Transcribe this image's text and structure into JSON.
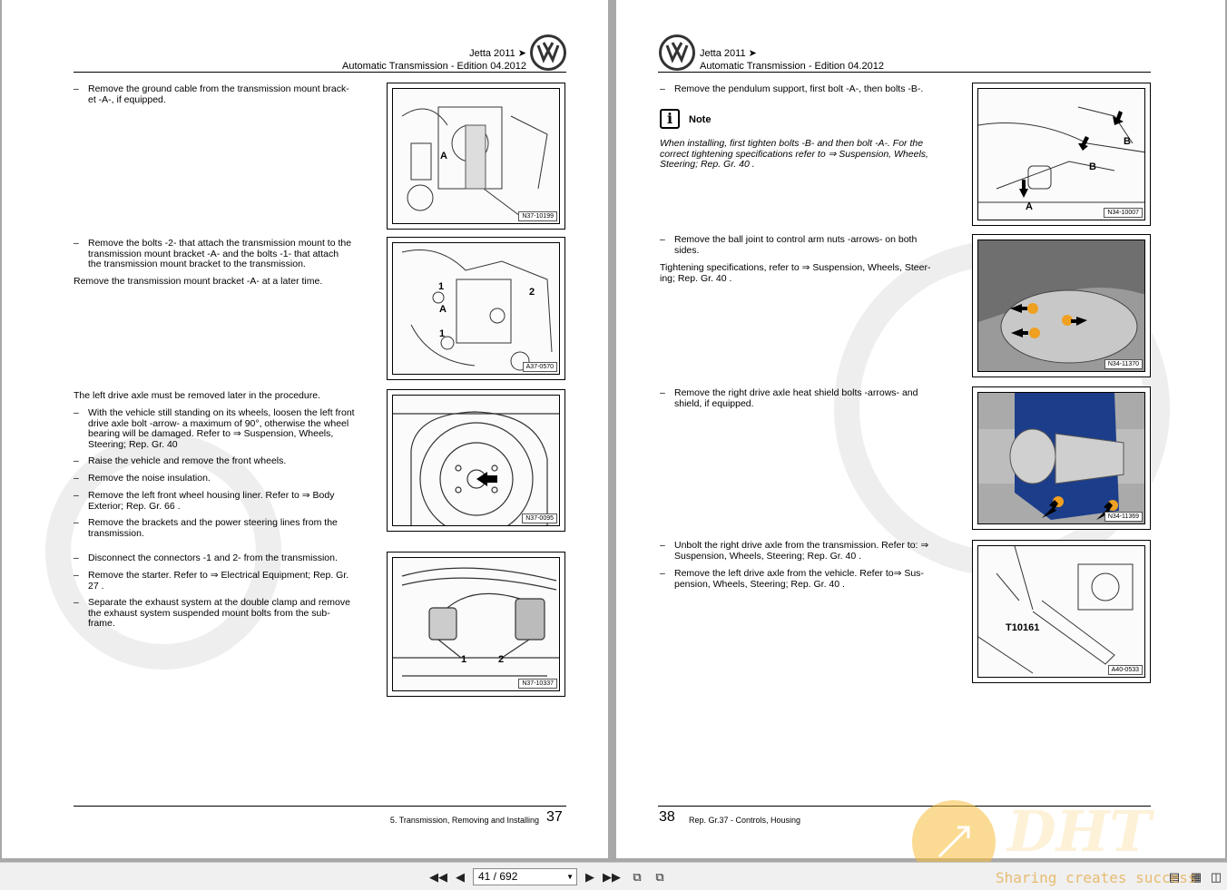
{
  "left_page": {
    "header": {
      "title": "Jetta 2011 ➤",
      "subtitle": "Automatic Transmission - Edition 04.2012"
    },
    "steps": [
      {
        "dash": "–",
        "text": "Remove the ground cable from the transmission mount brack-\net -A-, if equipped."
      },
      {
        "dash": "–",
        "text": "Remove the bolts -2- that attach the transmission mount to the\ntransmission mount bracket -A- and the bolts -1- that attach\nthe transmission mount bracket to the transmission."
      },
      {
        "dash": "–",
        "text": "With the vehicle still standing on its wheels, loosen the left front\ndrive axle bolt -arrow- a maximum of 90°, otherwise the wheel\nbearing will be damaged. Refer to ⇒ Suspension, Wheels,\nSteering; Rep. Gr. 40"
      },
      {
        "dash": "–",
        "text": "Raise the vehicle and remove the front wheels."
      },
      {
        "dash": "–",
        "text": "Remove the noise insulation."
      },
      {
        "dash": "–",
        "text": "Remove the left front wheel housing liner. Refer to ⇒ Body\nExterior; Rep. Gr. 66 ."
      },
      {
        "dash": "–",
        "text": "Remove the brackets and the power steering lines from the\ntransmission."
      },
      {
        "dash": "–",
        "text": "Disconnect the connectors -1 and 2- from the transmission."
      },
      {
        "dash": "–",
        "text": "Remove the starter. Refer to ⇒ Electrical Equipment; Rep. Gr.\n27 ."
      },
      {
        "dash": "–",
        "text": "Separate the exhaust system at the double clamp and remove\nthe exhaust system suspended mount bolts from the sub-\nframe."
      }
    ],
    "plain": [
      "Remove the transmission mount bracket -A- at a later time.",
      "The left drive axle must be removed later in the procedure."
    ],
    "figures": [
      {
        "label": "N37-10199",
        "callouts": [
          "A"
        ]
      },
      {
        "label": "A37-0570",
        "callouts": [
          "1",
          "2",
          "A",
          "1"
        ]
      },
      {
        "label": "N37-0095",
        "callouts": []
      },
      {
        "label": "N37-10337",
        "callouts": [
          "1",
          "2"
        ]
      }
    ],
    "footer": {
      "section": "5. Transmission, Removing and Installing",
      "page": "37"
    }
  },
  "right_page": {
    "header": {
      "title": "Jetta 2011 ➤",
      "subtitle": "Automatic Transmission - Edition 04.2012"
    },
    "steps": [
      {
        "dash": "–",
        "text": "Remove the pendulum support, first bolt -A-, then bolts -B-."
      },
      {
        "dash": "–",
        "text": "Remove the ball joint to control arm nuts -arrows- on both\nsides."
      },
      {
        "dash": "–",
        "text": "Remove the right drive axle heat shield bolts -arrows- and\nshield, if equipped."
      },
      {
        "dash": "–",
        "text": "Unbolt the right drive axle from the transmission. Refer to: ⇒\nSuspension, Wheels, Steering; Rep. Gr. 40 ."
      },
      {
        "dash": "–",
        "text": "Remove the left drive axle from the vehicle. Refer to⇒ Sus-\npension, Wheels, Steering; Rep. Gr. 40 ."
      }
    ],
    "note": {
      "icon": "i",
      "title": "Note",
      "text": "When installing, first tighten bolts -B- and then bolt -A-. For the\ncorrect tightening specifications refer to ⇒ Suspension, Wheels,\nSteering; Rep. Gr. 40 ."
    },
    "plain": [
      "Tightening specifications, refer to ⇒ Suspension, Wheels, Steer-\ning; Rep. Gr. 40 ."
    ],
    "figures": [
      {
        "label": "N34-10007",
        "callouts": [
          "B",
          "B",
          "A"
        ]
      },
      {
        "label": "N34-11370",
        "callouts": []
      },
      {
        "label": "N34-11369",
        "callouts": []
      },
      {
        "label": "A40-0533",
        "callouts": [
          "T10161"
        ]
      }
    ],
    "footer": {
      "section": "Rep. Gr.37 - Controls, Housing",
      "page": "38"
    }
  },
  "toolbar": {
    "page_indicator": "41 / 692",
    "first_icon": "first-page-icon",
    "prev_icon": "previous-page-icon",
    "next_icon": "next-page-icon",
    "last_icon": "last-page-icon"
  },
  "watermark": {
    "brand": "DHT",
    "slogan": "Sharing creates success"
  }
}
